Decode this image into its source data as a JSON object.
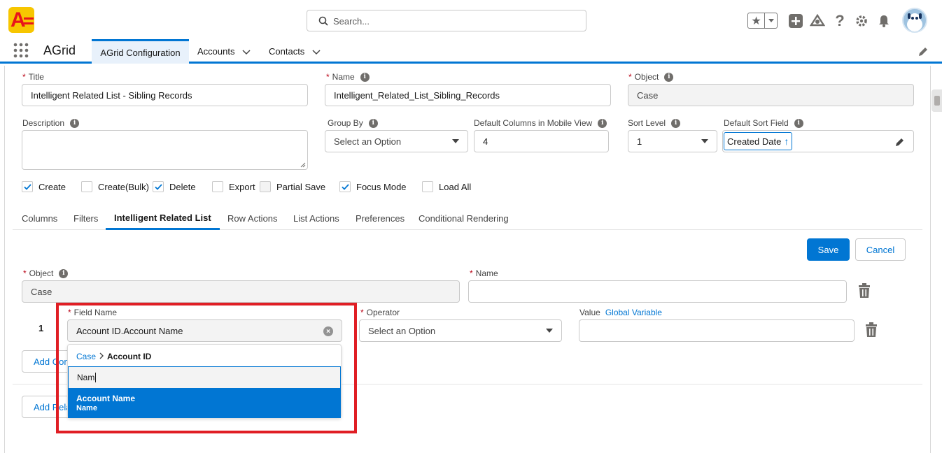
{
  "header": {
    "search_placeholder": "Search..."
  },
  "nav": {
    "app_name": "AGrid",
    "tabs": [
      {
        "label": "AGrid Configuration"
      },
      {
        "label": "Accounts"
      },
      {
        "label": "Contacts"
      }
    ]
  },
  "form": {
    "title_label": "Title",
    "title_value": "Intelligent Related List - Sibling Records",
    "name_label": "Name",
    "name_value": "Intelligent_Related_List_Sibling_Records",
    "object_label": "Object",
    "object_value": "Case",
    "description_label": "Description",
    "group_by_label": "Group By",
    "group_by_value": "Select an Option",
    "mobile_cols_label": "Default Columns in Mobile View",
    "mobile_cols_value": "4",
    "sort_level_label": "Sort Level",
    "sort_level_value": "1",
    "sort_field_label": "Default Sort Field",
    "sort_field_value": "Created Date",
    "sort_arrow": "↑"
  },
  "checkboxes": [
    {
      "label": "Create",
      "checked": true
    },
    {
      "label": "Create(Bulk)",
      "checked": false
    },
    {
      "label": "Delete",
      "checked": true
    },
    {
      "label": "Export",
      "checked": false
    },
    {
      "label": "Partial Save",
      "checked": false
    },
    {
      "label": "Focus Mode",
      "checked": true
    },
    {
      "label": "Load All",
      "checked": false
    }
  ],
  "tabs": [
    {
      "label": "Columns"
    },
    {
      "label": "Filters"
    },
    {
      "label": "Intelligent Related List"
    },
    {
      "label": "Row Actions"
    },
    {
      "label": "List Actions"
    },
    {
      "label": "Preferences"
    },
    {
      "label": "Conditional Rendering"
    }
  ],
  "actions": {
    "save_label": "Save",
    "cancel_label": "Cancel"
  },
  "related": {
    "object_label": "Object",
    "object_value": "Case",
    "name_label": "Name",
    "name_value": "",
    "row_number": "1",
    "field_name_label": "Field Name",
    "field_name_value": "Account ID.Account Name",
    "operator_label": "Operator",
    "operator_value": "Select an Option",
    "value_label": "Value",
    "global_variable_link": "Global Variable",
    "value_value": "",
    "add_condition_label": "Add Condition",
    "add_related_label": "Add Related List"
  },
  "dropdown": {
    "crumb_root": "Case",
    "crumb_current": "Account ID",
    "search_text": "Nam",
    "option_label": "Account Name",
    "option_api": "Name"
  },
  "colors": {
    "brand": "#0176d3",
    "highlight": "#e01e24"
  }
}
